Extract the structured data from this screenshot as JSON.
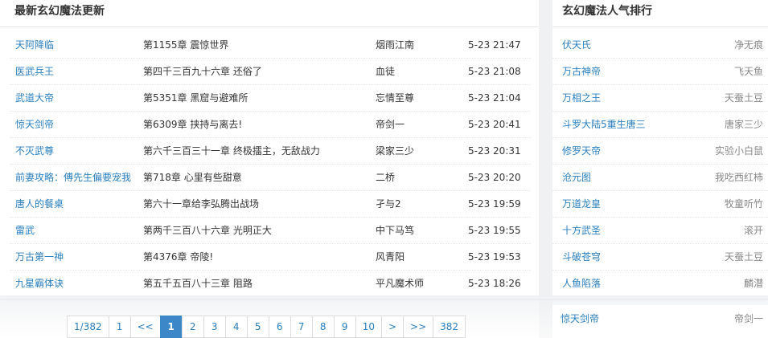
{
  "left": {
    "title": "最新玄幻魔法更新",
    "rows": [
      {
        "book": "天阿降临",
        "chapter": "第1155章 震惊世界",
        "author": "烟雨江南",
        "time": "5-23 21:47"
      },
      {
        "book": "医武兵王",
        "chapter": "第四千三百九十六章 还俗了",
        "author": "血徒",
        "time": "5-23 21:08"
      },
      {
        "book": "武道大帝",
        "chapter": "第5351章 黑窟与避难所",
        "author": "忘情至尊",
        "time": "5-23 21:04"
      },
      {
        "book": "惊天剑帝",
        "chapter": "第6309章 挟持与离去!",
        "author": "帝剑一",
        "time": "5-23 20:41"
      },
      {
        "book": "不灭武尊",
        "chapter": "第六千三百三十一章 终极擂主，无敌战力",
        "author": "梁家三少",
        "time": "5-23 20:31"
      },
      {
        "book": "前妻攻略：傅先生偏要宠我",
        "chapter": "第718章 心里有些甜意",
        "author": "二桥",
        "time": "5-23 20:20"
      },
      {
        "book": "唐人的餐桌",
        "chapter": "第六十一章给李弘腾出战场",
        "author": "孑与2",
        "time": "5-23 19:59"
      },
      {
        "book": "雷武",
        "chapter": "第两千三百八十六章 光明正大",
        "author": "中下马笃",
        "time": "5-23 19:55"
      },
      {
        "book": "万古第一神",
        "chapter": "第4376章 帝陵!",
        "author": "风青阳",
        "time": "5-23 19:53"
      },
      {
        "book": "九星霸体诀",
        "chapter": "第五千五百八十三章 阻路",
        "author": "平凡魔术师",
        "time": "5-23 18:26"
      }
    ]
  },
  "right": {
    "title": "玄幻魔法人气排行",
    "rows": [
      {
        "book": "伏天氏",
        "author": "净无痕"
      },
      {
        "book": "万古神帝",
        "author": "飞天鱼"
      },
      {
        "book": "万相之王",
        "author": "天蚕土豆"
      },
      {
        "book": "斗罗大陆5重生唐三",
        "author": "唐家三少"
      },
      {
        "book": "修罗天帝",
        "author": "实验小白鼠"
      },
      {
        "book": "沧元图",
        "author": "我吃西红柿"
      },
      {
        "book": "万道龙皇",
        "author": "牧童听竹"
      },
      {
        "book": "十方武圣",
        "author": "滚开"
      },
      {
        "book": "斗破苍穹",
        "author": "天蚕土豆"
      },
      {
        "book": "人鱼陷落",
        "author": "麟潜"
      }
    ],
    "bottom_row": {
      "book": "惊天剑帝",
      "author": "帝剑一"
    }
  },
  "pager": {
    "summary": "1/382",
    "first": "1",
    "prev": "<<",
    "pages": [
      "1",
      "2",
      "3",
      "4",
      "5",
      "6",
      "7",
      "8",
      "9",
      "10"
    ],
    "current": "1",
    "next": ">",
    "next_fast": ">>",
    "last": "382"
  },
  "colors": {
    "link": "#2a7fbf",
    "accent": "#3b87c8"
  }
}
